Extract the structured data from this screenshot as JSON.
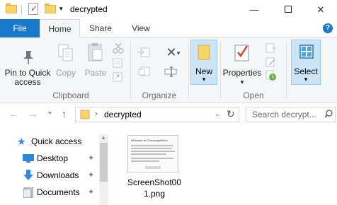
{
  "titlebar": {
    "title": "decrypted",
    "quick_access_toolbar": [
      "folder-icon",
      "properties-icon",
      "new-folder-icon"
    ],
    "dropdown_glyph": "▾",
    "min_glyph": "—",
    "close_glyph": "✕"
  },
  "tabs": {
    "file": "File",
    "home": "Home",
    "share": "Share",
    "view": "View",
    "help_glyph": "?"
  },
  "ribbon": {
    "clipboard": {
      "pin_label_1": "Pin to Quick",
      "pin_label_2": "access",
      "copy": "Copy",
      "paste": "Paste",
      "group_label": "Clipboard"
    },
    "organize": {
      "group_label": "Organize",
      "delete_glyph": "✕",
      "drop_glyph": "▾"
    },
    "new": {
      "new_label": "New",
      "drop_glyph": "▾"
    },
    "open": {
      "properties": "Properties",
      "group_label": "Open",
      "drop_glyph": "▾"
    },
    "select": {
      "select_label": "Select",
      "drop_glyph": "▾"
    }
  },
  "nav": {
    "back_glyph": "←",
    "forward_glyph": "→",
    "recent_glyph": "⌄",
    "up_glyph": "↑",
    "address_chevron": "›",
    "address": "decrypted",
    "address_dropdown": "⌄",
    "refresh_glyph": "↻",
    "search_placeholder": "Search decrypt..."
  },
  "navpane": {
    "items": [
      {
        "label": "Quick access",
        "icon": "star-icon"
      },
      {
        "label": "Desktop",
        "icon": "desktop-icon",
        "pinned": true
      },
      {
        "label": "Downloads",
        "icon": "download-icon",
        "pinned": true
      },
      {
        "label": "Documents",
        "icon": "documents-icon",
        "pinned": true
      }
    ],
    "pin_glyph": "📌",
    "scroll_up_glyph": "▲"
  },
  "files": [
    {
      "name": "ScreenShot001.png",
      "thumbnail_title": "Welcome to CrococryptMirror"
    }
  ],
  "colors": {
    "file_tab": "#1979ca",
    "ribbon_bg": "#f5f6f7",
    "selected_button": "#cce4f7",
    "folder_yellow": "#f7d46a"
  }
}
